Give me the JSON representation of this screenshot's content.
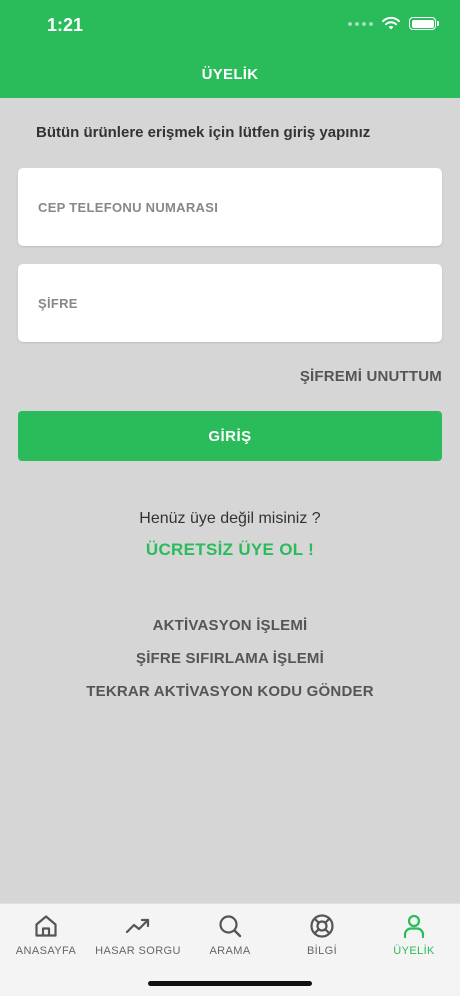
{
  "status": {
    "time": "1:21"
  },
  "header": {
    "title": "ÜYELİK"
  },
  "intro": "Bütün ürünlere erişmek için lütfen giriş yapınız",
  "form": {
    "phone_placeholder": "CEP TELEFONU NUMARASI",
    "password_placeholder": "ŞİFRE",
    "forgot_label": "ŞİFREMİ UNUTTUM",
    "login_label": "GİRİŞ"
  },
  "signup": {
    "question": "Henüz üye değil misiniz ?",
    "register_label": "ÜCRETSİZ ÜYE OL !"
  },
  "links": {
    "activation": "AKTİVASYON İŞLEMİ",
    "password_reset": "ŞİFRE SIFIRLAMA İŞLEMİ",
    "resend_code": "TEKRAR AKTİVASYON KODU GÖNDER"
  },
  "tabs": [
    {
      "label": "ANASAYFA",
      "icon": "home-icon"
    },
    {
      "label": "HASAR SORGU",
      "icon": "trending-up-icon"
    },
    {
      "label": "ARAMA",
      "icon": "search-icon"
    },
    {
      "label": "BİLGİ",
      "icon": "lifebuoy-icon"
    },
    {
      "label": "ÜYELİK",
      "icon": "user-icon",
      "active": true
    }
  ],
  "colors": {
    "accent": "#2abb5b",
    "background": "#d6d6d6",
    "tab_inactive": "#666666"
  }
}
